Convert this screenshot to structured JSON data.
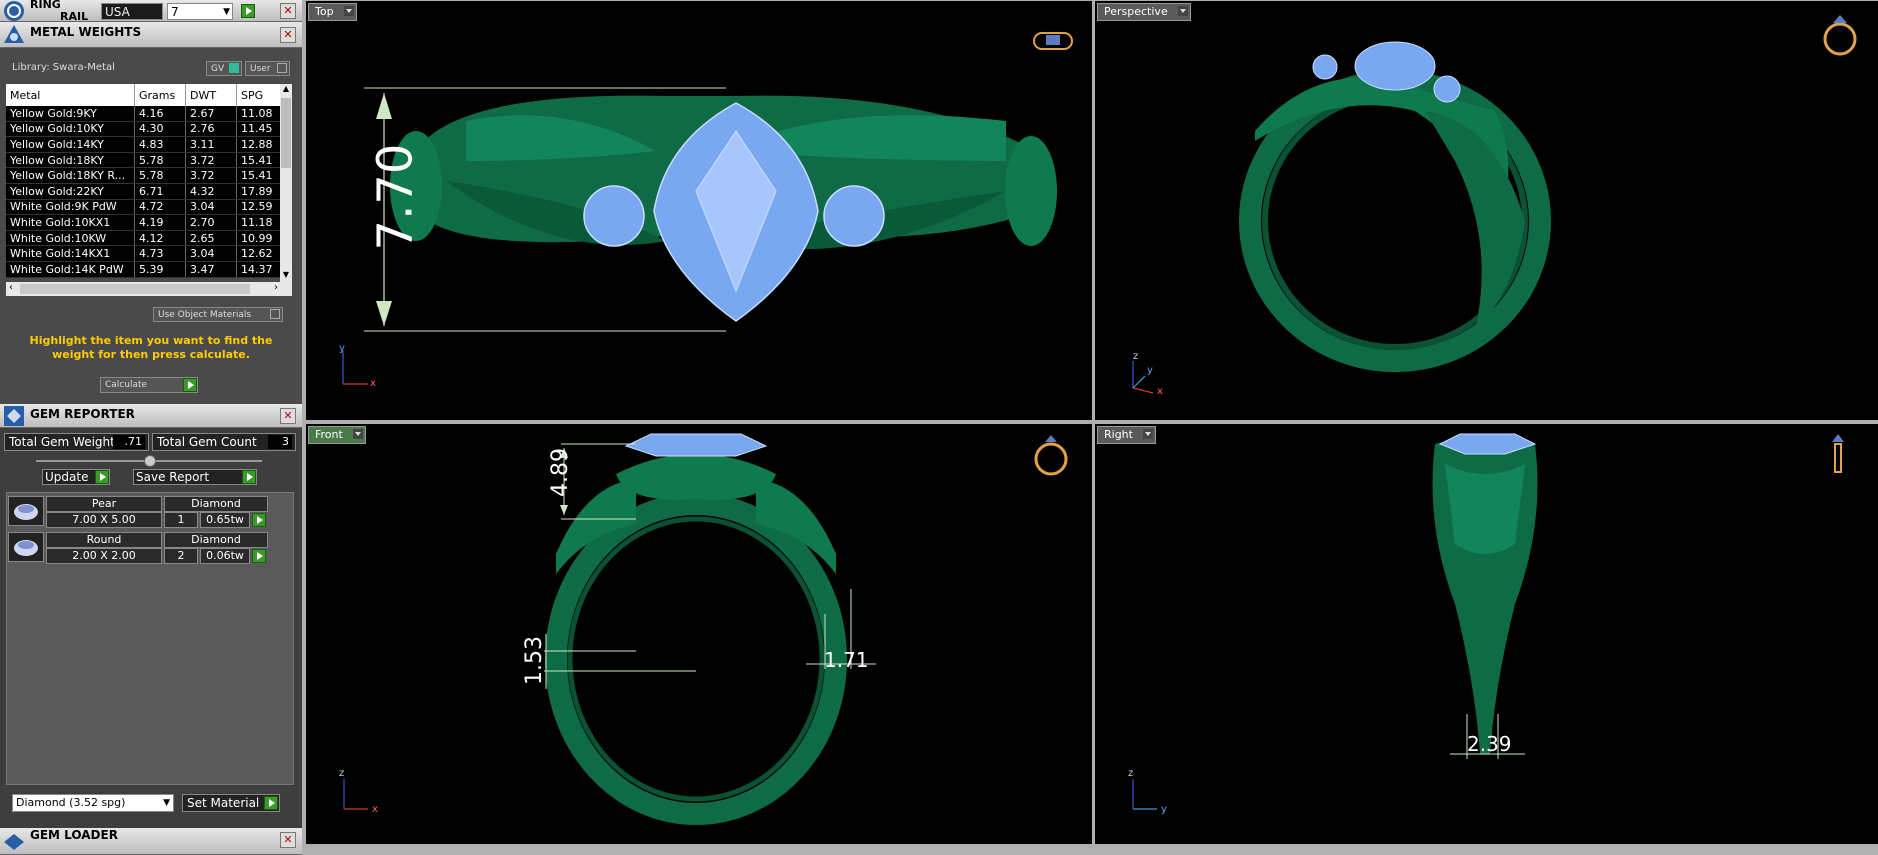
{
  "ring_rail": {
    "title_line1": "RING",
    "title_line2": "RAIL",
    "country": "USA",
    "size": "7"
  },
  "metal_weights": {
    "title": "METAL WEIGHTS",
    "library": "Library: Swara-Metal",
    "gv": "GV",
    "user": "User",
    "columns": [
      "Metal",
      "Grams",
      "DWT",
      "SPG"
    ],
    "rows": [
      [
        "Yellow Gold:9KY",
        "4.16",
        "2.67",
        "11.08"
      ],
      [
        "Yellow Gold:10KY",
        "4.30",
        "2.76",
        "11.45"
      ],
      [
        "Yellow Gold:14KY",
        "4.83",
        "3.11",
        "12.88"
      ],
      [
        "Yellow Gold:18KY",
        "5.78",
        "3.72",
        "15.41"
      ],
      [
        "Yellow Gold:18KY R...",
        "5.78",
        "3.72",
        "15.41"
      ],
      [
        "Yellow Gold:22KY",
        "6.71",
        "4.32",
        "17.89"
      ],
      [
        "White Gold:9K PdW",
        "4.72",
        "3.04",
        "12.59"
      ],
      [
        "White Gold:10KX1",
        "4.19",
        "2.70",
        "11.18"
      ],
      [
        "White Gold:10KW",
        "4.12",
        "2.65",
        "10.99"
      ],
      [
        "White Gold:14KX1",
        "4.73",
        "3.04",
        "12.62"
      ],
      [
        "White Gold:14K PdW",
        "5.39",
        "3.47",
        "14.37"
      ]
    ],
    "use_object_materials": "Use Object Materials",
    "message": "Highlight the item you want to find the weight for then press calculate.",
    "calculate": "Calculate"
  },
  "gem_reporter": {
    "title": "GEM REPORTER",
    "total_weight_label": "Total Gem Weight",
    "total_weight": ".71",
    "total_count_label": "Total Gem Count",
    "total_count": "3",
    "update": "Update",
    "save_report": "Save Report",
    "gems": [
      {
        "shape": "Pear",
        "material": "Diamond",
        "size": "7.00 X 5.00",
        "qty": "1",
        "tw": "0.65tw"
      },
      {
        "shape": "Round",
        "material": "Diamond",
        "size": "2.00 X 2.00",
        "qty": "2",
        "tw": "0.06tw"
      }
    ],
    "material_select": "Diamond   (3.52 spg)",
    "set_material": "Set Material"
  },
  "gem_loader": {
    "title": "GEM LOADER"
  },
  "viewports": {
    "top": {
      "label": "Top",
      "dim": "7.70"
    },
    "perspective": {
      "label": "Perspective"
    },
    "front": {
      "label": "Front",
      "dim_top": "4.89",
      "dim_bottom": "1.53",
      "dim_right": "1.71"
    },
    "right": {
      "label": "Right",
      "dim": "2.39"
    }
  },
  "axes": {
    "x": "x",
    "y": "y",
    "z": "z"
  },
  "colors": {
    "metal": "#0e6b45",
    "gem": "#7aa8f0",
    "viewport_bg": "#000000"
  }
}
